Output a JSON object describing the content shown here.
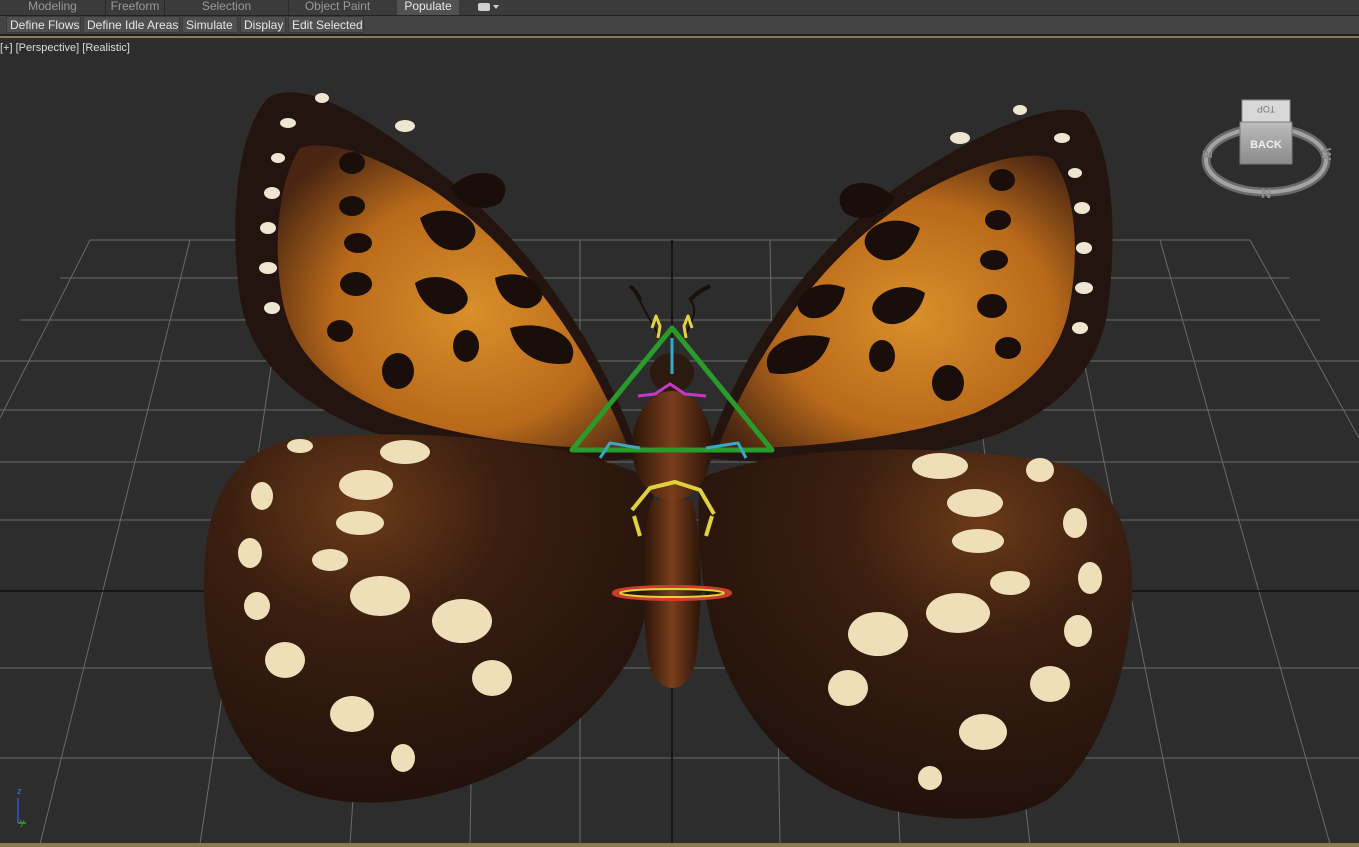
{
  "ribbon": {
    "tabs": [
      "Modeling",
      "Freeform",
      "Selection",
      "Object Paint",
      "Populate"
    ],
    "active_tab": "Populate"
  },
  "toolbar": {
    "buttons": [
      "Define Flows",
      "Define Idle Areas",
      "Simulate",
      "Display",
      "Edit Selected"
    ]
  },
  "viewport": {
    "label_plus": "[+]",
    "label_view": "[Perspective]",
    "label_shading": "[Realistic]"
  },
  "viewcube": {
    "face": "BACK",
    "top": "TOP",
    "compass_s": "N",
    "compass_e": "W",
    "compass_w": "E"
  },
  "axis": {
    "z": "z",
    "y": "y"
  },
  "colors": {
    "accent": "#8a7a52",
    "wing_orange": "#c67a1e",
    "wing_dark": "#2a1610",
    "spot_cream": "#efe0be",
    "rig_green": "#2a9a2a",
    "rig_yellow": "#e0d23c",
    "rig_cyan": "#3aa7c8",
    "rig_magenta": "#c638c6",
    "rig_red": "#d23a2a"
  }
}
